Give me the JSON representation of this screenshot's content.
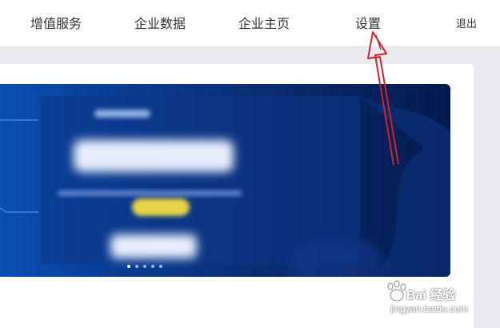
{
  "nav": {
    "items": [
      "增值服务",
      "企业数据",
      "企业主页",
      "设置"
    ],
    "logout": "退出"
  },
  "banner": {
    "slide_count": 5,
    "active_slide": 1
  },
  "annotation": {
    "arrow_color": "#d0202c"
  },
  "watermark": {
    "brand": "Bai 经验",
    "url": "jingyan.baidu.com"
  }
}
